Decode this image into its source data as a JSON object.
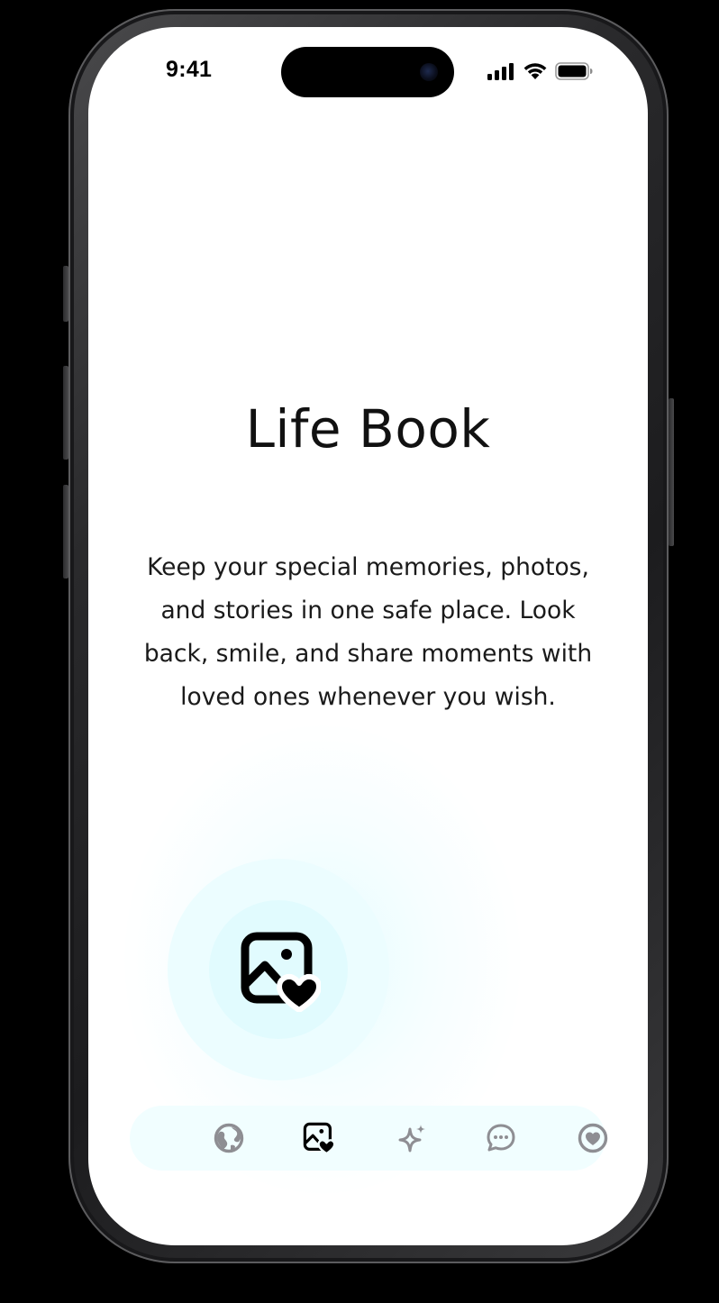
{
  "status_bar": {
    "time": "9:41",
    "icons": [
      "cellular-signal-icon",
      "wifi-icon",
      "battery-icon"
    ]
  },
  "screen": {
    "title": "Life Book",
    "description": "Keep your special memories, photos, and stories in one safe place. Look back, smile, and share moments with loved ones whenever you wish.",
    "hero_icon": "photo-heart-icon"
  },
  "tab_bar": {
    "items": [
      {
        "icon": "globe-icon",
        "active": false
      },
      {
        "icon": "photo-heart-icon",
        "active": true
      },
      {
        "icon": "sparkle-icon",
        "active": false
      },
      {
        "icon": "chat-bubble-icon",
        "active": false
      },
      {
        "icon": "heart-circle-icon",
        "active": false
      }
    ]
  },
  "colors": {
    "background": "#000000",
    "screen": "#ffffff",
    "text": "#111111",
    "glow": "#e1fbfe",
    "tab_bar": "#f1feff",
    "icon_inactive": "#8e8e93",
    "icon_active": "#000000"
  }
}
